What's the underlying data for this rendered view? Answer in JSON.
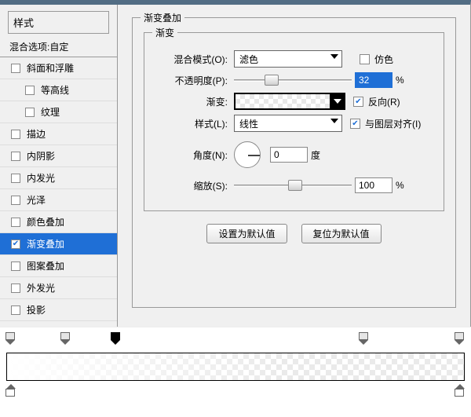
{
  "left": {
    "styles_title": "样式",
    "blend_options": "混合选项:自定",
    "items": [
      {
        "label": "斜面和浮雕",
        "checked": false,
        "sub": false
      },
      {
        "label": "等高线",
        "checked": false,
        "sub": true
      },
      {
        "label": "纹理",
        "checked": false,
        "sub": true
      },
      {
        "label": "描边",
        "checked": false,
        "sub": false
      },
      {
        "label": "内阴影",
        "checked": false,
        "sub": false
      },
      {
        "label": "内发光",
        "checked": false,
        "sub": false
      },
      {
        "label": "光泽",
        "checked": false,
        "sub": false
      },
      {
        "label": "颜色叠加",
        "checked": false,
        "sub": false
      },
      {
        "label": "渐变叠加",
        "checked": true,
        "sub": false,
        "selected": true
      },
      {
        "label": "图案叠加",
        "checked": false,
        "sub": false
      },
      {
        "label": "外发光",
        "checked": false,
        "sub": false
      },
      {
        "label": "投影",
        "checked": false,
        "sub": false
      }
    ]
  },
  "panel": {
    "outer_title": "渐变叠加",
    "inner_title": "渐变",
    "labels": {
      "blend_mode": "混合模式(O):",
      "opacity": "不透明度(P):",
      "gradient": "渐变:",
      "style": "样式(L):",
      "angle": "角度(N):",
      "scale": "缩放(S):",
      "dither": "仿色",
      "reverse": "反向(R)",
      "align": "与图层对齐(I)",
      "deg": "度",
      "pct": "%"
    },
    "values": {
      "blend_mode": "滤色",
      "opacity": "32",
      "style": "线性",
      "angle": "0",
      "scale": "100",
      "dither": false,
      "reverse": true,
      "align": true,
      "opacity_thumb_pct": 32,
      "scale_thumb_pct": 52
    },
    "buttons": {
      "make_default": "设置为默认值",
      "reset_default": "复位为默认值"
    }
  },
  "chart_data": {
    "type": "gradient",
    "opacity_stops": [
      {
        "position": 1,
        "selected": false
      },
      {
        "position": 13,
        "selected": false
      },
      {
        "position": 24,
        "selected": true
      },
      {
        "position": 78,
        "selected": false
      },
      {
        "position": 99,
        "selected": false
      }
    ],
    "color_stops": [
      {
        "position": 1,
        "color": "#ffffff"
      },
      {
        "position": 99,
        "color": "#ffffff"
      }
    ]
  }
}
